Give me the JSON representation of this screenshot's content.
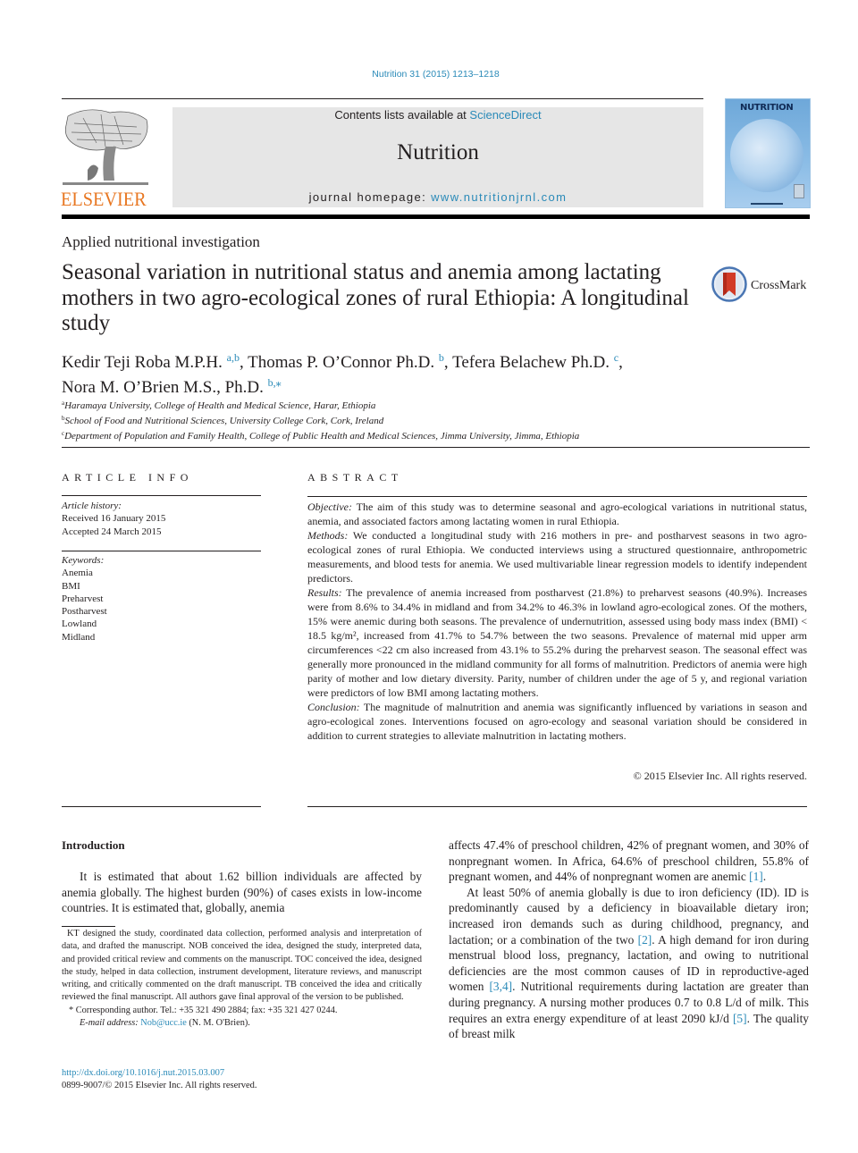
{
  "header": {
    "citation": "Nutrition 31 (2015) 1213–1218",
    "publisher_logo_text": "ELSEVIER",
    "contents_prefix": "Contents lists available at ",
    "contents_link": "ScienceDirect",
    "journal_name": "Nutrition",
    "homepage_prefix": "journal homepage: ",
    "homepage_link": "www.nutritionjrnl.com",
    "cover_title": "NUTRITION",
    "colors": {
      "link": "#2a8ab8",
      "elsevier_orange": "#e87722",
      "masthead_bg": "#e6e6e6"
    }
  },
  "article": {
    "section_type": "Applied nutritional investigation",
    "title": "Seasonal variation in nutritional status and anemia among lactating mothers in two agro-ecological zones of rural Ethiopia: A longitudinal study",
    "crossmark_label": "CrossMark",
    "authors": [
      {
        "name": "Kedir Teji Roba M.P.H.",
        "sup": "a,b",
        "sep": ", "
      },
      {
        "name": "Thomas P. O’Connor Ph.D.",
        "sup": "b",
        "sep": ", "
      },
      {
        "name": "Tefera Belachew Ph.D.",
        "sup": "c",
        "sep": ","
      },
      {
        "name": "Nora M. O’Brien M.S., Ph.D.",
        "sup": "b,⁎",
        "sep": ""
      }
    ],
    "affiliations": [
      {
        "key": "a",
        "text": "Haramaya University, College of Health and Medical Science, Harar, Ethiopia"
      },
      {
        "key": "b",
        "text": "School of Food and Nutritional Sciences, University College Cork, Cork, Ireland"
      },
      {
        "key": "c",
        "text": "Department of Population and Family Health, College of Public Health and Medical Sciences, Jimma University, Jimma, Ethiopia"
      }
    ]
  },
  "article_info": {
    "heading": "ARTICLE INFO",
    "history_label": "Article history:",
    "received": "Received 16 January 2015",
    "accepted": "Accepted 24 March 2015",
    "keywords_label": "Keywords:",
    "keywords": [
      "Anemia",
      "BMI",
      "Preharvest",
      "Postharvest",
      "Lowland",
      "Midland"
    ]
  },
  "abstract": {
    "heading": "ABSTRACT",
    "sections": [
      {
        "label": "Objective:",
        "text": " The aim of this study was to determine seasonal and agro-ecological variations in nutritional status, anemia, and associated factors among lactating women in rural Ethiopia."
      },
      {
        "label": "Methods:",
        "text": " We conducted a longitudinal study with 216 mothers in pre- and postharvest seasons in two agro-ecological zones of rural Ethiopia. We conducted interviews using a structured questionnaire, anthropometric measurements, and blood tests for anemia. We used multivariable linear regression models to identify independent predictors."
      },
      {
        "label": "Results:",
        "text": " The prevalence of anemia increased from postharvest (21.8%) to preharvest seasons (40.9%). Increases were from 8.6% to 34.4% in midland and from 34.2% to 46.3% in lowland agro-ecological zones. Of the mothers, 15% were anemic during both seasons. The prevalence of undernutrition, assessed using body mass index (BMI) < 18.5 kg/m², increased from 41.7% to 54.7% between the two seasons. Prevalence of maternal mid upper arm circumferences <22 cm also increased from 43.1% to 55.2% during the preharvest season. The seasonal effect was generally more pronounced in the midland community for all forms of malnutrition. Predictors of anemia were high parity of mother and low dietary diversity. Parity, number of children under the age of 5 y, and regional variation were predictors of low BMI among lactating mothers."
      },
      {
        "label": "Conclusion:",
        "text": " The magnitude of malnutrition and anemia was significantly influenced by variations in season and agro-ecological zones. Interventions focused on agro-ecology and seasonal variation should be considered in addition to current strategies to alleviate malnutrition in lactating mothers."
      }
    ],
    "copyright": "© 2015 Elsevier Inc. All rights reserved."
  },
  "body": {
    "intro_heading": "Introduction",
    "left_paragraph": "It is estimated that about 1.62 billion individuals are affected by anemia globally. The highest burden (90%) of cases exists in low-income countries. It is estimated that, globally, anemia",
    "right_p1_a": "affects 47.4% of preschool children, 42% of pregnant women, and 30% of nonpregnant women. In Africa, 64.6% of preschool children, 55.8% of pregnant women, and 44% of nonpregnant women are anemic ",
    "right_p1_ref": "[1]",
    "right_p1_b": ".",
    "right_p2_a": "At least 50% of anemia globally is due to iron deficiency (ID). ID is predominantly caused by a deficiency in bioavailable dietary iron; increased iron demands such as during childhood, pregnancy, and lactation; or a combination of the two ",
    "right_p2_ref1": "[2]",
    "right_p2_b": ". A high demand for iron during menstrual blood loss, pregnancy, lactation, and owing to nutritional deficiencies are the most common causes of ID in reproductive-aged women ",
    "right_p2_ref2": "[3,4]",
    "right_p2_c": ". Nutritional requirements during lactation are greater than during pregnancy. A nursing mother produces 0.7 to 0.8 L/d of milk. This requires an extra energy expenditure of at least 2090 kJ/d ",
    "right_p2_ref3": "[5]",
    "right_p2_d": ". The quality of breast milk"
  },
  "footnotes": {
    "contributions": "KT designed the study, coordinated data collection, performed analysis and interpretation of data, and drafted the manuscript. NOB conceived the idea, designed the study, interpreted data, and provided critical review and comments on the manuscript. TOC conceived the idea, designed the study, helped in data collection, instrument development, literature reviews, and manuscript writing, and critically commented on the draft manuscript. TB conceived the idea and critically reviewed the final manuscript. All authors gave final approval of the version to be published.",
    "corresponding": "* Corresponding author. Tel.: +35 321 490 2884; fax: +35 321 427 0244.",
    "email_label": "E-mail address:",
    "email": "Nob@ucc.ie",
    "email_suffix": " (N. M. O'Brien).",
    "doi": "http://dx.doi.org/10.1016/j.nut.2015.03.007",
    "issn_copyright": "0899-9007/© 2015 Elsevier Inc. All rights reserved."
  }
}
